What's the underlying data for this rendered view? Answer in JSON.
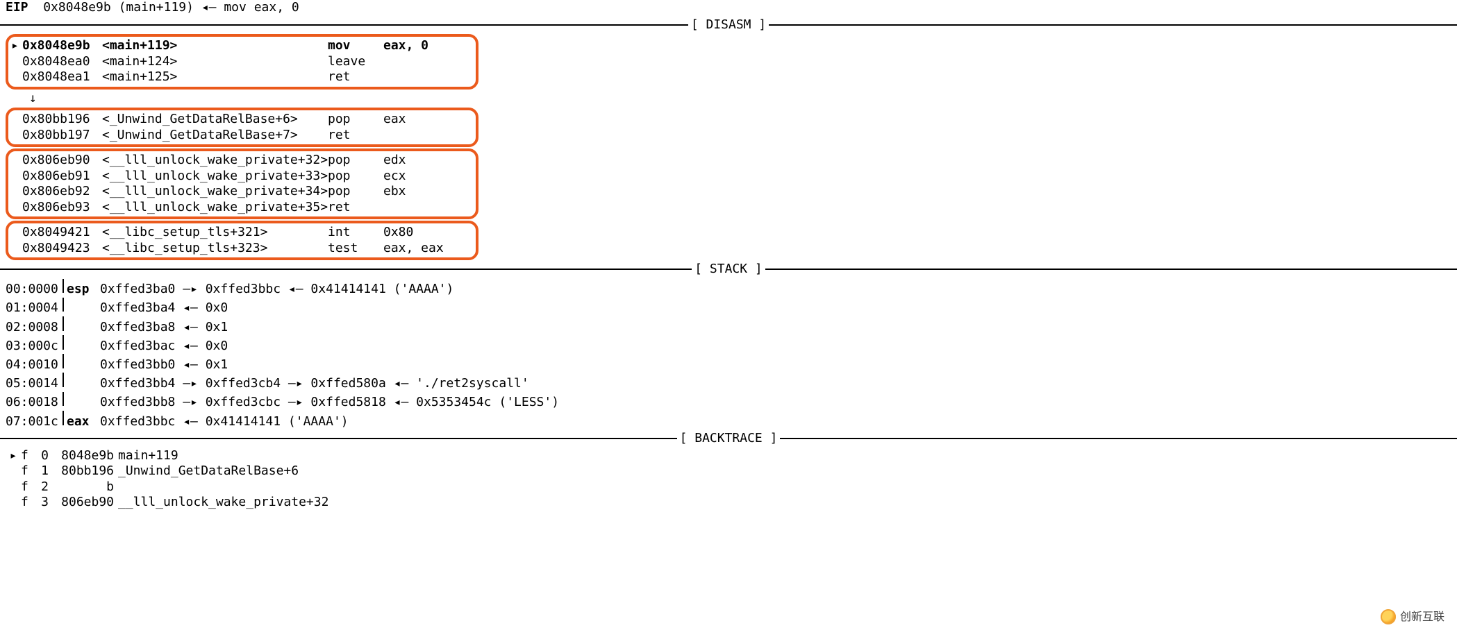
{
  "header": {
    "reg_label": "EIP",
    "addr": "0x8048e9b",
    "sym": "(main+119)",
    "arrow": "◂—",
    "instr": "mov    eax, 0"
  },
  "sections": {
    "disasm": "[ DISASM ]",
    "stack": "[ STACK ]",
    "backtrace": "[ BACKTRACE ]"
  },
  "disasm": {
    "g1": [
      {
        "mark": "▸",
        "addr": "0x8048e9b",
        "sym": "<main+119>",
        "op": "mov",
        "args": "eax, 0",
        "bold": true
      },
      {
        "mark": "",
        "addr": "0x8048ea0",
        "sym": "<main+124>",
        "op": "leave",
        "args": ""
      },
      {
        "mark": "",
        "addr": "0x8048ea1",
        "sym": "<main+125>",
        "op": "ret",
        "args": ""
      }
    ],
    "flow1": "↓",
    "g2": [
      {
        "mark": "",
        "addr": "0x80bb196",
        "sym": "<_Unwind_GetDataRelBase+6>",
        "op": "pop",
        "args": "eax"
      },
      {
        "mark": "",
        "addr": "0x80bb197",
        "sym": "<_Unwind_GetDataRelBase+7>",
        "op": "ret",
        "args": ""
      }
    ],
    "g3": [
      {
        "mark": "",
        "addr": "0x806eb90",
        "sym": "<__lll_unlock_wake_private+32>",
        "op": "pop",
        "args": "edx"
      },
      {
        "mark": "",
        "addr": "0x806eb91",
        "sym": "<__lll_unlock_wake_private+33>",
        "op": "pop",
        "args": "ecx"
      },
      {
        "mark": "",
        "addr": "0x806eb92",
        "sym": "<__lll_unlock_wake_private+34>",
        "op": "pop",
        "args": "ebx"
      },
      {
        "mark": "",
        "addr": "0x806eb93",
        "sym": "<__lll_unlock_wake_private+35>",
        "op": "ret",
        "args": ""
      }
    ],
    "g4": [
      {
        "mark": "",
        "addr": "0x8049421",
        "sym": "<__libc_setup_tls+321>",
        "op": "int",
        "args": "0x80"
      },
      {
        "mark": "",
        "addr": "0x8049423",
        "sym": "<__libc_setup_tls+323>",
        "op": "test",
        "args": "eax, eax"
      }
    ]
  },
  "stack": [
    {
      "idx": "00:0000",
      "reg": "esp",
      "chain": "0xffed3ba0 —▸ 0xffed3bbc ◂— 0x41414141 ('AAAA')"
    },
    {
      "idx": "01:0004",
      "reg": "",
      "chain": "0xffed3ba4 ◂— 0x0"
    },
    {
      "idx": "02:0008",
      "reg": "",
      "chain": "0xffed3ba8 ◂— 0x1"
    },
    {
      "idx": "03:000c",
      "reg": "",
      "chain": "0xffed3bac ◂— 0x0"
    },
    {
      "idx": "04:0010",
      "reg": "",
      "chain": "0xffed3bb0 ◂— 0x1"
    },
    {
      "idx": "05:0014",
      "reg": "",
      "chain": "0xffed3bb4 —▸ 0xffed3cb4 —▸ 0xffed580a ◂— './ret2syscall'"
    },
    {
      "idx": "06:0018",
      "reg": "",
      "chain": "0xffed3bb8 —▸ 0xffed3cbc —▸ 0xffed5818 ◂— 0x5353454c ('LESS')"
    },
    {
      "idx": "07:001c",
      "reg": "eax",
      "chain": "0xffed3bbc ◂— 0x41414141 ('AAAA')"
    }
  ],
  "backtrace": [
    {
      "mark": "▸",
      "f": "f",
      "n": "0",
      "addr": "8048e9b",
      "sym": "main+119"
    },
    {
      "mark": "",
      "f": "f",
      "n": "1",
      "addr": "80bb196",
      "sym": "_Unwind_GetDataRelBase+6"
    },
    {
      "mark": "",
      "f": "f",
      "n": "2",
      "addr": "b",
      "sym": ""
    },
    {
      "mark": "",
      "f": "f",
      "n": "3",
      "addr": "806eb90",
      "sym": "__lll_unlock_wake_private+32"
    }
  ],
  "watermark": "创新互联"
}
